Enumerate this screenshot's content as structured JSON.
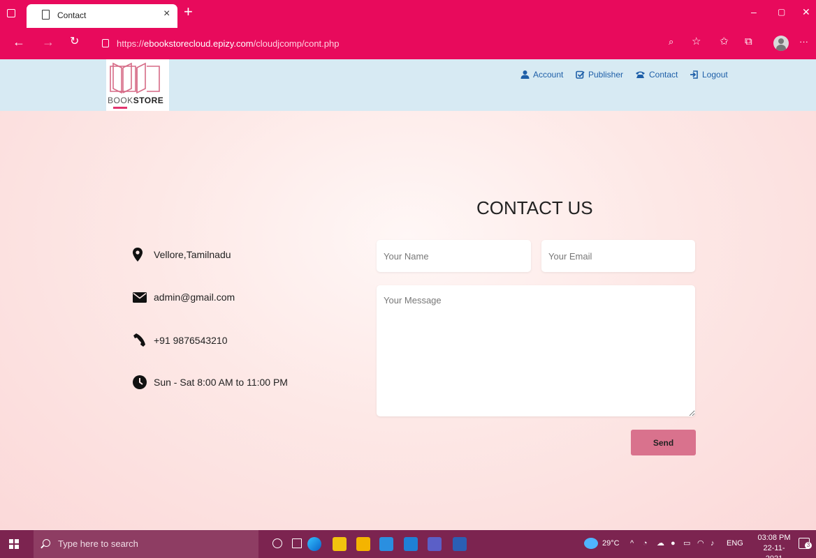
{
  "browser": {
    "tab_title": "Contact",
    "tab_close": "×",
    "new_tab": "+",
    "url_scheme": "https://",
    "url_host": "ebookstorecloud.epizy.com",
    "url_path": "/cloudjcomp/cont.php",
    "window_minimize": "–",
    "window_restore": "▢",
    "window_close": "✕",
    "more_menu": "···"
  },
  "site": {
    "logo_text_light": "BOOK",
    "logo_text_bold": "STORE",
    "nav": [
      {
        "label": "Account",
        "icon": "user-icon"
      },
      {
        "label": "Publisher",
        "icon": "check-square-icon"
      },
      {
        "label": "Contact",
        "icon": "phone-icon"
      },
      {
        "label": "Logout",
        "icon": "logout-icon"
      }
    ]
  },
  "contact": {
    "title": "CONTACT US",
    "info": [
      {
        "icon": "map-marker-icon",
        "text": "Vellore,Tamilnadu"
      },
      {
        "icon": "envelope-icon",
        "text": "admin@gmail.com"
      },
      {
        "icon": "phone-icon",
        "text": "+91 9876543210"
      },
      {
        "icon": "clock-icon",
        "text": "Sun - Sat 8:00 AM to 11:00 PM"
      }
    ],
    "form": {
      "name_placeholder": "Your Name",
      "name_value": "",
      "email_placeholder": "Your Email",
      "email_value": "",
      "message_placeholder": "Your Message",
      "message_value": "",
      "send_label": "Send"
    }
  },
  "taskbar": {
    "search_placeholder": "Type here to search",
    "weather": "29°C",
    "language": "ENG",
    "time": "03:08 PM",
    "date": "22-11-2021",
    "notification_count": "3"
  },
  "colors": {
    "browser_accent": "#e80a5c",
    "header_bg": "#d7eaf3",
    "nav_link": "#1e5fa8",
    "send_button": "#d9728d",
    "taskbar_bg": "#7c2450"
  }
}
